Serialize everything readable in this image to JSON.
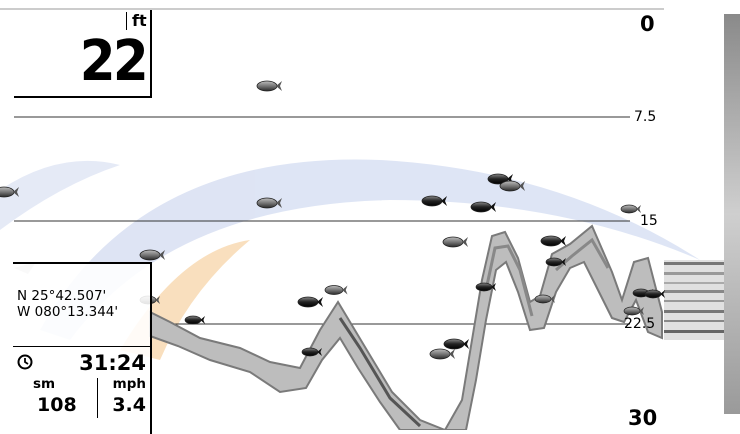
{
  "depth": {
    "value": "22",
    "unit": "ft"
  },
  "depth_scale": {
    "top": "0",
    "bottom": "30",
    "lines": [
      "7.5",
      "15",
      "22.5"
    ]
  },
  "gps": {
    "lat": "N 25°42.507'",
    "lon": "W 080°13.344'"
  },
  "timer": {
    "icon": "clock-icon",
    "value": "31:24"
  },
  "distance": {
    "unit": "sm",
    "value": "108"
  },
  "speed": {
    "unit": "mph",
    "value": "3.4"
  },
  "colors": {
    "background": "#ffffff",
    "text": "#000000",
    "watermark_blue": "#c9d3ec",
    "watermark_orange": "#f7cf9a"
  }
}
